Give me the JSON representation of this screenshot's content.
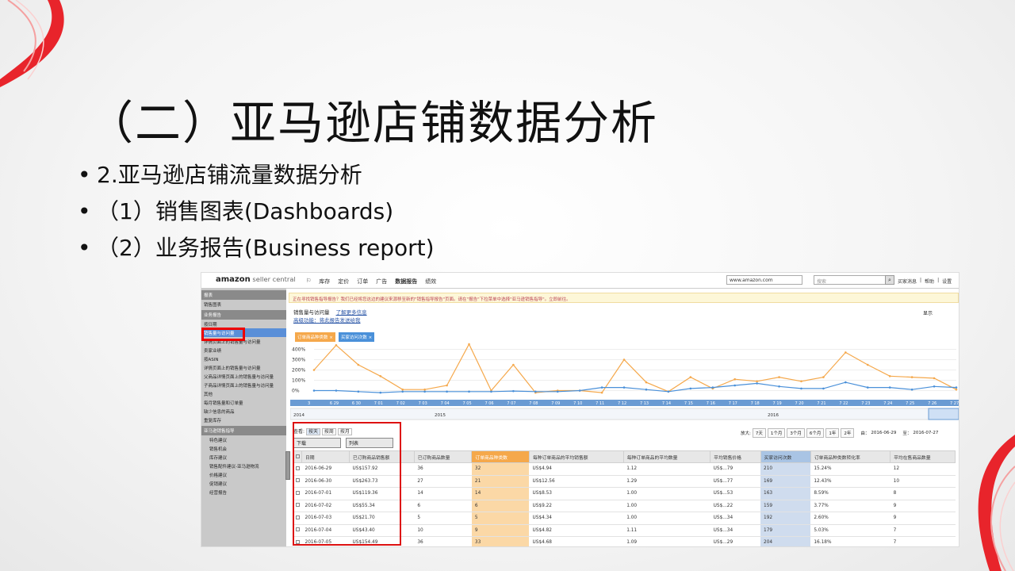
{
  "slide": {
    "title": "（二）亚马逊店铺数据分析",
    "bullets": [
      "2.亚马逊店铺流量数据分析",
      "（1）销售图表(Dashboards)",
      "（2）业务报告(Business report)"
    ]
  },
  "seller": {
    "logo_main": "amazon",
    "logo_sub": " seller central",
    "nav": [
      "库存",
      "定价",
      "订单",
      "广告",
      "数据报告",
      "绩效"
    ],
    "site": "www.amazon.com",
    "search_placeholder": "搜索",
    "top_links": [
      "买家消息",
      "帮助",
      "设置"
    ],
    "notice": "正在寻找销售指导报告？我们已经将您这边的建议来源移至新的\"销售指导报告\"页面。请在\"报告\"下拉菜单中选择\"亚马逊销售指导\"。立即前往。",
    "sidebar": [
      {
        "label": "报表",
        "type": "sec"
      },
      {
        "label": "销售图表",
        "type": "it"
      },
      {
        "label": "业务报告",
        "type": "sec"
      },
      {
        "label": "按日期",
        "type": "it"
      },
      {
        "label": "销售量与访问量",
        "type": "hl"
      },
      {
        "label": "详情页面上的销售量与访问量",
        "type": "it"
      },
      {
        "label": "卖家业绩",
        "type": "it"
      },
      {
        "label": "按ASIN",
        "type": "it"
      },
      {
        "label": "详情页面上的销售量与访问量",
        "type": "it"
      },
      {
        "label": "父商品详情页面上的销售量与访问量",
        "type": "it"
      },
      {
        "label": "子商品详情页面上的销售量与访问量",
        "type": "it"
      },
      {
        "label": "其他",
        "type": "it"
      },
      {
        "label": "每月销售量和订单量",
        "type": "it"
      },
      {
        "label": "缺少信息的商品",
        "type": "it"
      },
      {
        "label": "重复库存",
        "type": "it"
      },
      {
        "label": "亚马逊销售指导",
        "type": "sec"
      },
      {
        "label": "特色建议",
        "type": "sub"
      },
      {
        "label": "销售机会",
        "type": "sub"
      },
      {
        "label": "库存建议",
        "type": "sub"
      },
      {
        "label": "销售配件建议-亚马逊物流",
        "type": "sub"
      },
      {
        "label": "价格建议",
        "type": "sub"
      },
      {
        "label": "促销建议",
        "type": "sub"
      },
      {
        "label": "经营报告",
        "type": "sub"
      }
    ],
    "chart_title": "销售量与访问量",
    "chart_link1": "了解更多信息",
    "chart_link2": "高级功能：将此报告发送给我",
    "chart_export": "显示",
    "chips": [
      {
        "label": "订单商品种类数 ×",
        "color": "#f5a84b"
      },
      {
        "label": "买家访问次数 ×",
        "color": "#4a90d9"
      }
    ],
    "year_labels": [
      "2014",
      "2015",
      "2016"
    ],
    "view_label": "查看:",
    "view_tabs": [
      "按天",
      "按周",
      "按月"
    ],
    "select1": "下载",
    "select2": "列表",
    "range_label": "放大:",
    "range_buttons": [
      "7天",
      "1个月",
      "3个月",
      "6个月",
      "1年",
      "2年"
    ],
    "from_label": "由：",
    "from_date": "2016-06-29",
    "to_label": "至：",
    "to_date": "2016-07-27",
    "table": {
      "headers": [
        "日期",
        "已订购商品销售额",
        "已订购商品数量",
        "订单商品种类数",
        "每种订单商品的平均销售额",
        "每种订单商品的平均数量",
        "平均销售价格",
        "买家访问次数",
        "订单商品种类数转化率",
        "平均在售商品数量"
      ],
      "rows": [
        [
          "2016-06-29",
          "US$157.92",
          "36",
          "32",
          "US$4.94",
          "1.12",
          "US$...79",
          "210",
          "15.24%",
          "12"
        ],
        [
          "2016-06-30",
          "US$263.73",
          "27",
          "21",
          "US$12.56",
          "1.29",
          "US$...77",
          "169",
          "12.43%",
          "10"
        ],
        [
          "2016-07-01",
          "US$119.36",
          "14",
          "14",
          "US$8.53",
          "1.00",
          "US$...53",
          "163",
          "8.59%",
          "8"
        ],
        [
          "2016-07-02",
          "US$55.34",
          "6",
          "6",
          "US$9.22",
          "1.00",
          "US$...22",
          "159",
          "3.77%",
          "9"
        ],
        [
          "2016-07-03",
          "US$21.70",
          "5",
          "5",
          "US$4.34",
          "1.00",
          "US$...34",
          "192",
          "2.60%",
          "9"
        ],
        [
          "2016-07-04",
          "US$43.40",
          "10",
          "9",
          "US$4.82",
          "1.11",
          "US$...34",
          "179",
          "5.03%",
          "7"
        ],
        [
          "2016-07-05",
          "US$154.49",
          "36",
          "33",
          "US$4.68",
          "1.09",
          "US$...29",
          "204",
          "16.18%",
          "7"
        ]
      ]
    }
  },
  "chart_data": {
    "type": "line",
    "ylim": [
      0,
      400
    ],
    "yticks": [
      "400%",
      "300%",
      "200%",
      "100%",
      "0%"
    ],
    "x": [
      "3",
      "6.29",
      "6.30",
      "7.01",
      "7.02",
      "7.03",
      "7.04",
      "7.05",
      "7.06",
      "7.07",
      "7.08",
      "7.09",
      "7.10",
      "7.11",
      "7.12",
      "7.13",
      "7.14",
      "7.15",
      "7.16",
      "7.17",
      "7.18",
      "7.19",
      "7.20",
      "7.21",
      "7.22",
      "7.23",
      "7.24",
      "7.25",
      "7.26",
      "7.27"
    ],
    "xlabels": [
      "3",
      "6 29",
      "6 30",
      "7 01",
      "7 02",
      "7 03",
      "7 04",
      "7 05",
      "7 06",
      "7 07",
      "7 08",
      "7 09",
      "7 10",
      "7 11",
      "7 12",
      "7 13",
      "7 14",
      "7 15",
      "7 16",
      "7 17",
      "7 18",
      "7 19",
      "7 20",
      "7 21",
      "7 22",
      "7 23",
      "7 24",
      "7 25",
      "7 26",
      "7 27"
    ],
    "series": [
      {
        "color": "#f5a84b",
        "values": [
          200,
          440,
          250,
          140,
          10,
          10,
          50,
          450,
          0,
          250,
          -20,
          0,
          0,
          -20,
          300,
          80,
          -10,
          130,
          20,
          110,
          90,
          130,
          90,
          130,
          370,
          250,
          140,
          130,
          120,
          10
        ]
      },
      {
        "color": "#4a90d9",
        "values": [
          0,
          0,
          -10,
          -20,
          -10,
          -10,
          -10,
          -10,
          -10,
          -5,
          -10,
          -10,
          0,
          30,
          30,
          10,
          -10,
          20,
          30,
          50,
          70,
          40,
          20,
          20,
          80,
          30,
          30,
          10,
          40,
          30
        ]
      }
    ]
  }
}
